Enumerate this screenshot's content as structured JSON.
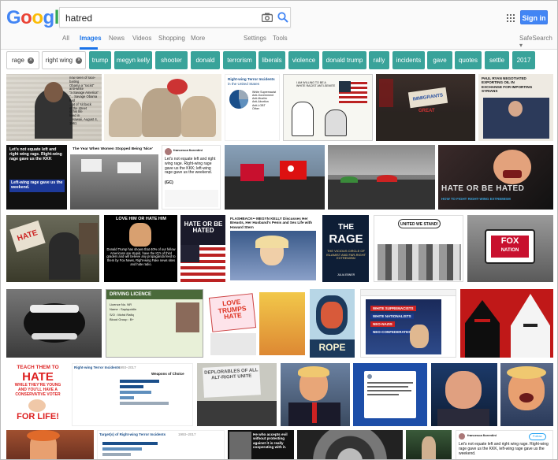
{
  "logo": {
    "letters": [
      "G",
      "o",
      "o",
      "g",
      "l",
      "e"
    ],
    "colors": [
      "#4285f4",
      "#ea4335",
      "#fbbc05",
      "#4285f4",
      "#34a853",
      "#ea4335"
    ]
  },
  "search": {
    "query": "hatred"
  },
  "header": {
    "sign_in": "Sign in",
    "accent": "#4285f4"
  },
  "tabs": {
    "all": "All",
    "images": "Images",
    "news": "News",
    "videos": "Videos",
    "shopping": "Shopping",
    "more": "More",
    "settings": "Settings",
    "tools": "Tools",
    "safesearch": "SafeSearch"
  },
  "chips": {
    "neutral": [
      "rage",
      "right wing"
    ],
    "items": [
      "trump",
      "megyn kelly",
      "shooter",
      "donald",
      "terrorism",
      "liberals",
      "violence",
      "donald trump",
      "rally",
      "incidents",
      "gave",
      "quotes",
      "settle",
      "2017"
    ],
    "color": "#39a39a"
  },
  "thumbs": {
    "t1": {
      "lines": [
        "now seen of race-baiting",
        "Obama a \"racist\"",
        "anti-white",
        "\"a Savage America\"",
        "\"... Savage Obama had",
        "...at of 'sit back",
        "of the street",
        "of his life",
        "lived in",
        "...Hawaii, August 4, 1961"
      ]
    },
    "t3": {
      "title": "Right-wing Terror Incidents",
      "sub": "in the United States",
      "legend": [
        "White Supremacist",
        "Anti-Government",
        "Anti-Muslim",
        "Anti-Abortion",
        "Anti-LGBT",
        "Other"
      ]
    },
    "t4": {
      "caption": "I AM WILLING TO BE A WHITE RACIST ANTI-SEMITE"
    },
    "t5": {
      "sign": "IMMIGRANTS",
      "sub": "GREAT"
    },
    "t6": {
      "lines": [
        "PAUL RYAN NEGOTIATED",
        "EXPORTING OIL IN",
        "EXCHANGE FOR IMPORTING",
        "SYRIANS"
      ]
    },
    "t7": {
      "text": "Let's not equate left and right wing rage. Right-wing rage gave us the KKK",
      "sub": "Left-wing rage gave us the weekend."
    },
    "t8": {
      "title": "The Year When Women Stopped Being 'Nice'"
    },
    "t9": {
      "name": "francesca fiorentini",
      "text": "Let's not equate left and right wing rage. Right-wing rage gave us the KKK; left-wing rage gave us the weekend.",
      "tag": "(GC)"
    },
    "t12": {
      "line1": "HATE OR BE HATED",
      "line2": "HOW TO FIGHT RIGHT-WING EXTREMISM"
    },
    "t13": {
      "sign": "HATE"
    },
    "t14": {
      "title": "LOVE HIM OR HATE HIM",
      "text": "Donald Trump has shown that 40% of our fellow Americans are stupid, have the IQ's of third graders and will believe any propaganda feed to them by Fox News, Right-wing Fake news sites and hate radio."
    },
    "t15": {
      "text": "HATE OR BE HATED"
    },
    "t16": {
      "title": "FLASHBACK•• MEGYN KELLY Discusses Her Breasts, Her Husband's Penis and Sex Life with Howard Stern"
    },
    "t17": {
      "l1": "THE",
      "l2": "RAGE",
      "sub": "THE VICIOUS CIRCLE OF ISLAMIST AND FAR-RIGHT EXTREMISM",
      "author": "JULIA EBNER"
    },
    "t18": {
      "text": "UNITED WE STAND!"
    },
    "t19": {
      "l1": "FOX",
      "l2": "NATION"
    },
    "t21": {
      "title": "DRIVING LICENCE",
      "fields": [
        "Licence No. NR",
        "Name : Sapiquddin",
        "S/O : Mohd Rafiq",
        "Blood Group : B+"
      ]
    },
    "t22": {
      "text": "LOVE TRUMPS HATE"
    },
    "t24": {
      "text": "ROPE"
    },
    "t25": {
      "items": [
        "WHITE SUPREMACISTS",
        "WHITE NATIONALISTS",
        "NEO-NAZIS",
        "NEO-CONFEDERATES"
      ]
    },
    "t27": {
      "lines": [
        "TEACH THEM TO",
        "HATE",
        "WHILE THEY'RE YOUNG",
        "AND YOU'LL HAVE A",
        "CONSERVATIVE VOTER",
        "FOR LIFE!"
      ]
    },
    "t28": {
      "title": "Right-wing Terror Incidents",
      "years": "1993–2017",
      "col": "Weapons of Choice"
    },
    "t29": {
      "text": "DEPLORABLES OF ALL ALT-RIGHT UNITE"
    },
    "t36": {
      "title": "Target(s) of Right-wing Terror Incidents",
      "years": "1993–2017"
    },
    "t37": {
      "text": "He who accepts evil without protesting against it is really cooperating with it."
    },
    "t39": {
      "name": "francesca fiorentini",
      "text": "Let's not equate left and right wing rage. Right-wing rage gave us the KKK, left-wing rage gave us the weekend.",
      "follow": "Follow"
    }
  }
}
